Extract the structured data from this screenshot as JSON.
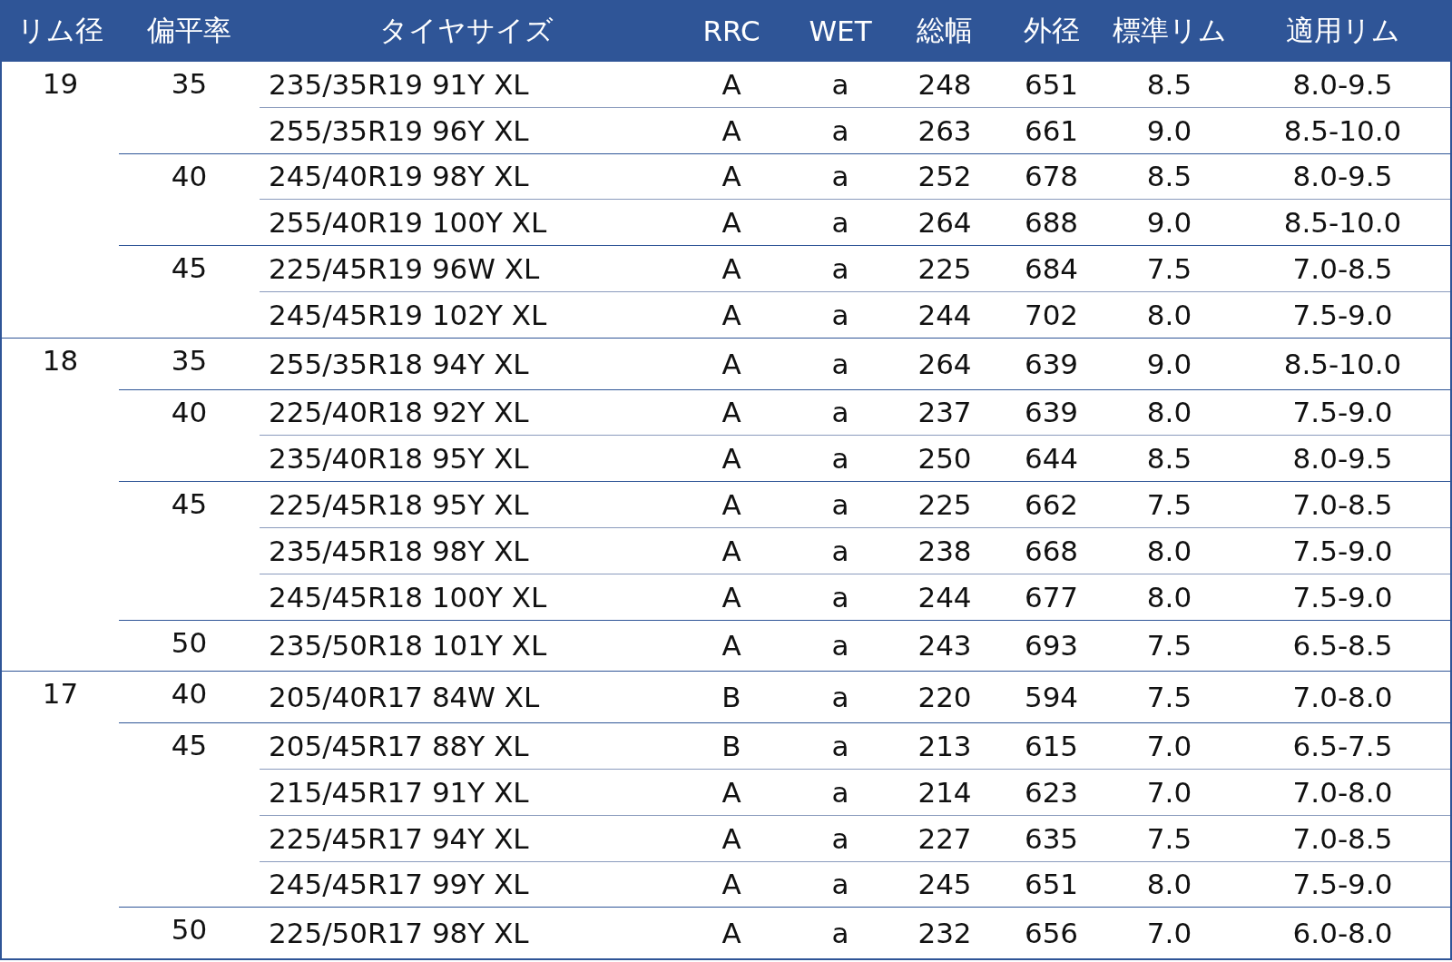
{
  "table": {
    "columns": [
      "リム径",
      "偏平率",
      "タイヤサイズ",
      "RRC",
      "WET",
      "総幅",
      "外径",
      "標準リム",
      "適用リム"
    ],
    "groups": [
      {
        "rim": "19",
        "aspects": [
          {
            "ratio": "35",
            "rows": [
              [
                "235/35R19 91Y XL",
                "A",
                "a",
                "248",
                "651",
                "8.5",
                "8.0-9.5"
              ],
              [
                "255/35R19 96Y XL",
                "A",
                "a",
                "263",
                "661",
                "9.0",
                "8.5-10.0"
              ]
            ]
          },
          {
            "ratio": "40",
            "rows": [
              [
                "245/40R19 98Y XL",
                "A",
                "a",
                "252",
                "678",
                "8.5",
                "8.0-9.5"
              ],
              [
                "255/40R19 100Y XL",
                "A",
                "a",
                "264",
                "688",
                "9.0",
                "8.5-10.0"
              ]
            ]
          },
          {
            "ratio": "45",
            "rows": [
              [
                "225/45R19 96W XL",
                "A",
                "a",
                "225",
                "684",
                "7.5",
                "7.0-8.5"
              ],
              [
                "245/45R19 102Y XL",
                "A",
                "a",
                "244",
                "702",
                "8.0",
                "7.5-9.0"
              ]
            ]
          }
        ]
      },
      {
        "rim": "18",
        "aspects": [
          {
            "ratio": "35",
            "rows": [
              [
                "255/35R18 94Y XL",
                "A",
                "a",
                "264",
                "639",
                "9.0",
                "8.5-10.0"
              ]
            ]
          },
          {
            "ratio": "40",
            "rows": [
              [
                "225/40R18 92Y XL",
                "A",
                "a",
                "237",
                "639",
                "8.0",
                "7.5-9.0"
              ],
              [
                "235/40R18 95Y XL",
                "A",
                "a",
                "250",
                "644",
                "8.5",
                "8.0-9.5"
              ]
            ]
          },
          {
            "ratio": "45",
            "rows": [
              [
                "225/45R18 95Y XL",
                "A",
                "a",
                "225",
                "662",
                "7.5",
                "7.0-8.5"
              ],
              [
                "235/45R18 98Y XL",
                "A",
                "a",
                "238",
                "668",
                "8.0",
                "7.5-9.0"
              ],
              [
                "245/45R18 100Y XL",
                "A",
                "a",
                "244",
                "677",
                "8.0",
                "7.5-9.0"
              ]
            ]
          },
          {
            "ratio": "50",
            "rows": [
              [
                "235/50R18 101Y XL",
                "A",
                "a",
                "243",
                "693",
                "7.5",
                "6.5-8.5"
              ]
            ]
          }
        ]
      },
      {
        "rim": "17",
        "aspects": [
          {
            "ratio": "40",
            "rows": [
              [
                "205/40R17 84W XL",
                "B",
                "a",
                "220",
                "594",
                "7.5",
                "7.0-8.0"
              ]
            ]
          },
          {
            "ratio": "45",
            "rows": [
              [
                "205/45R17 88Y XL",
                "B",
                "a",
                "213",
                "615",
                "7.0",
                "6.5-7.5"
              ],
              [
                "215/45R17 91Y XL",
                "A",
                "a",
                "214",
                "623",
                "7.0",
                "7.0-8.0"
              ],
              [
                "225/45R17 94Y XL",
                "A",
                "a",
                "227",
                "635",
                "7.5",
                "7.0-8.5"
              ],
              [
                "245/45R17 99Y XL",
                "A",
                "a",
                "245",
                "651",
                "8.0",
                "7.5-9.0"
              ]
            ]
          },
          {
            "ratio": "50",
            "rows": [
              [
                "225/50R17 98Y XL",
                "A",
                "a",
                "232",
                "656",
                "7.0",
                "6.0-8.0"
              ]
            ]
          }
        ]
      }
    ]
  }
}
